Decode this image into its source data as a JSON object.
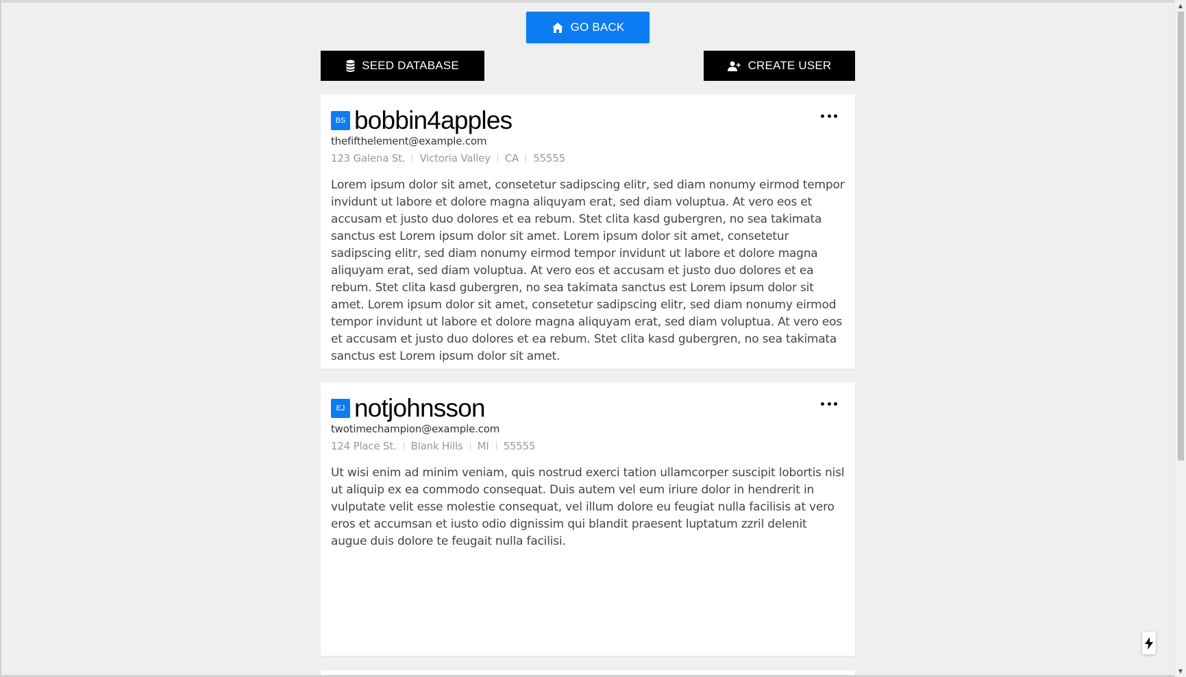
{
  "nav": {
    "go_back_label": "GO BACK",
    "seed_database_label": "SEED DATABASE",
    "create_user_label": "CREATE USER"
  },
  "accent_color": "#0d7cf2",
  "users": [
    {
      "initials": "BS",
      "username": "bobbin4apples",
      "email": "thefifthelement@example.com",
      "address": {
        "street": "123 Galena St.",
        "city": "Victoria Valley",
        "state": "CA",
        "zip": "55555"
      },
      "bio": "Lorem ipsum dolor sit amet, consetetur sadipscing elitr, sed diam nonumy eirmod tempor invidunt ut labore et dolore magna aliquyam erat, sed diam voluptua. At vero eos et accusam et justo duo dolores et ea rebum. Stet clita kasd gubergren, no sea takimata sanctus est Lorem ipsum dolor sit amet. Lorem ipsum dolor sit amet, consetetur sadipscing elitr, sed diam nonumy eirmod tempor invidunt ut labore et dolore magna aliquyam erat, sed diam voluptua. At vero eos et accusam et justo duo dolores et ea rebum. Stet clita kasd gubergren, no sea takimata sanctus est Lorem ipsum dolor sit amet. Lorem ipsum dolor sit amet, consetetur sadipscing elitr, sed diam nonumy eirmod tempor invidunt ut labore et dolore magna aliquyam erat, sed diam voluptua. At vero eos et accusam et justo duo dolores et ea rebum. Stet clita kasd gubergren, no sea takimata sanctus est Lorem ipsum dolor sit amet."
    },
    {
      "initials": "EJ",
      "username": "notjohnsson",
      "email": "twotimechampion@example.com",
      "address": {
        "street": "124 Place St.",
        "city": "Blank Hills",
        "state": "MI",
        "zip": "55555"
      },
      "bio": "Ut wisi enim ad minim veniam, quis nostrud exerci tation ullamcorper suscipit lobortis nisl ut aliquip ex ea commodo consequat. Duis autem vel eum iriure dolor in hendrerit in vulputate velit esse molestie consequat, vel illum dolore eu feugiat nulla facilisis at vero eros et accumsan et iusto odio dignissim qui blandit praesent luptatum zzril delenit augue duis dolore te feugait nulla facilisi."
    }
  ],
  "icons": {
    "go_back": "home-icon",
    "seed_database": "database-icon",
    "create_user": "user-plus-icon",
    "card_menu": "more-horizontal-icon",
    "floating": "lightning-icon"
  }
}
